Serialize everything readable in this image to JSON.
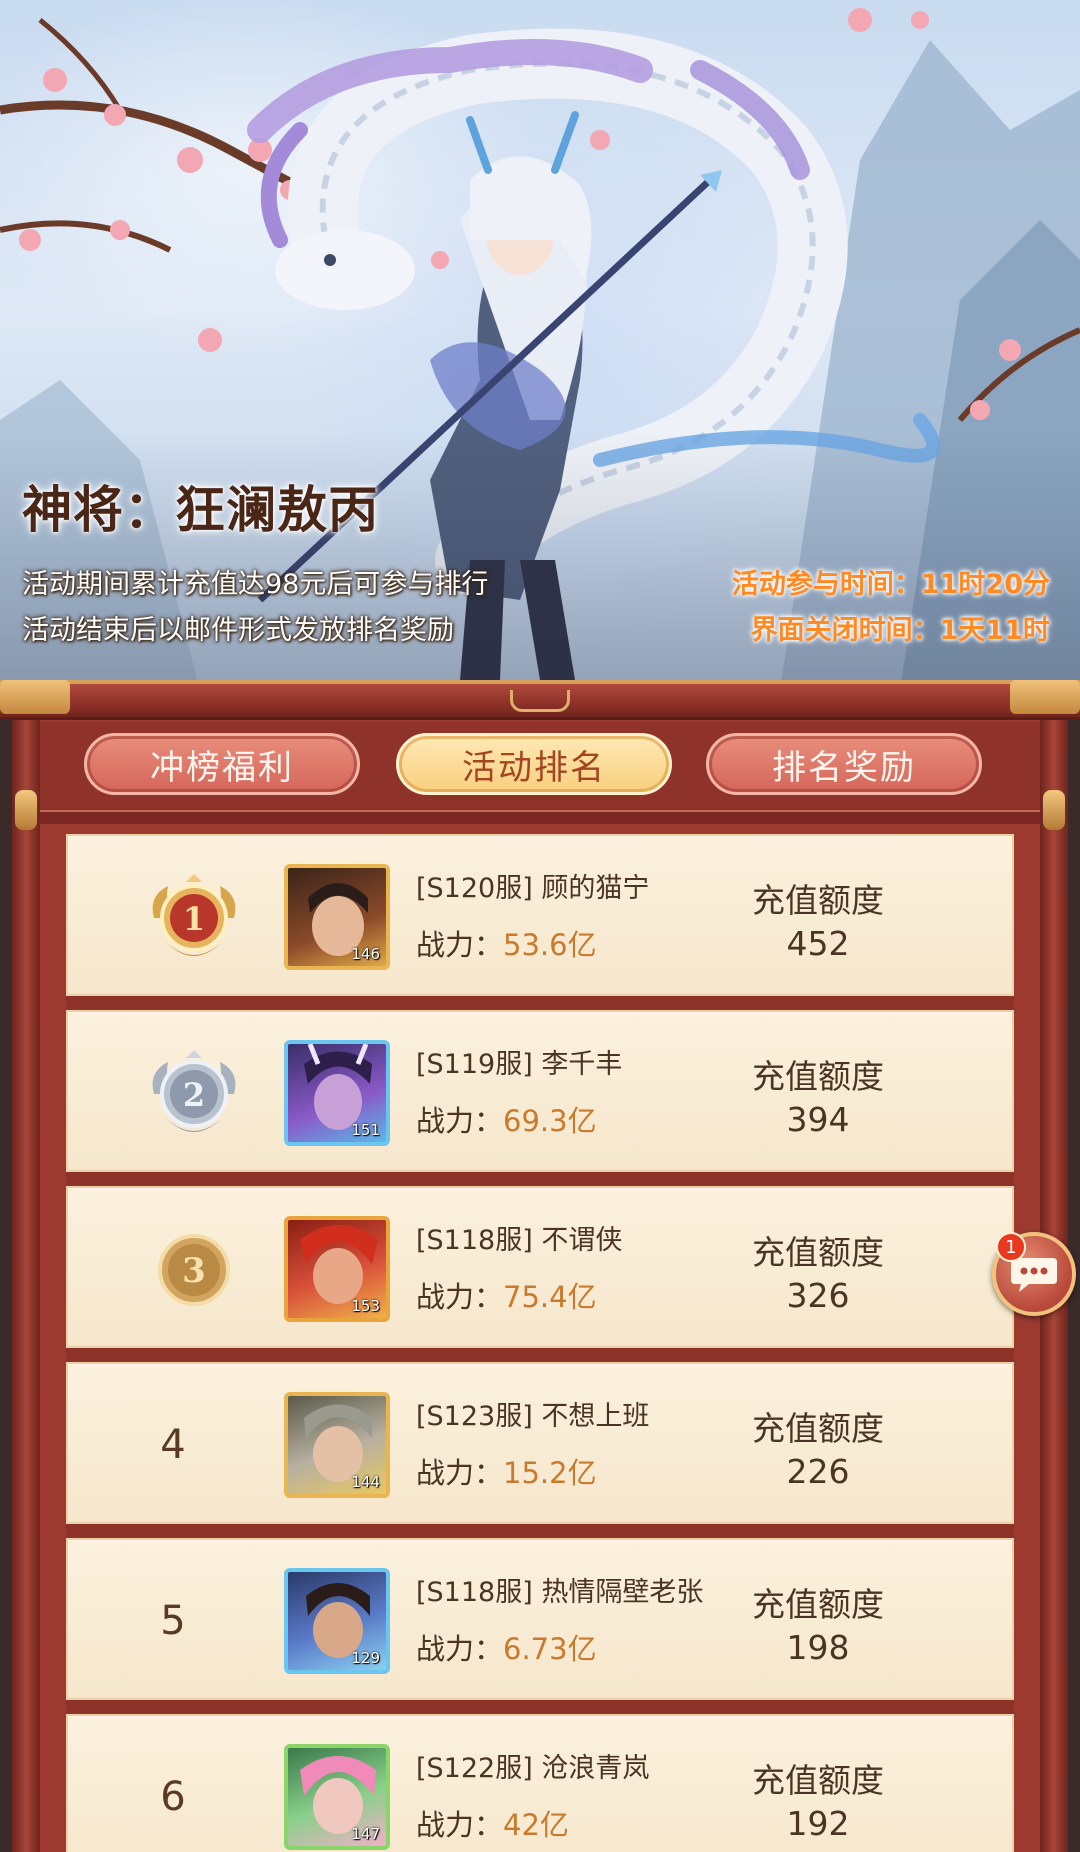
{
  "banner": {
    "hero_title": "神将：狂澜敖丙",
    "rule_line_1": "活动期间累计充值达98元后可参与排行",
    "rule_line_2": "活动结束后以邮件形式发放排名奖励",
    "participation_time": "活动参与时间：11时20分",
    "close_time": "界面关闭时间：1天11时"
  },
  "tabs": [
    {
      "label": "冲榜福利",
      "active": false
    },
    {
      "label": "活动排名",
      "active": true
    },
    {
      "label": "排名奖励",
      "active": false
    }
  ],
  "colors": {
    "frame_red": "#9c3a30",
    "row_cream": "#fbf1de",
    "power_orange": "#c97a2c",
    "timer_orange": "#ff8a24",
    "gold": "#e7b45e",
    "silver": "#b9c3cf",
    "bronze": "#d2a460"
  },
  "ranking": {
    "power_prefix": "战力：",
    "recharge_label": "充值额度",
    "rows": [
      {
        "rank": "1",
        "medal": "gold-medal-icon",
        "avatar_level": "146",
        "player": "[S120服] 顾的猫宁",
        "power": "53.6亿",
        "recharge": "452"
      },
      {
        "rank": "2",
        "medal": "silver-medal-icon",
        "avatar_level": "151",
        "player": "[S119服] 李千丰",
        "power": "69.3亿",
        "recharge": "394"
      },
      {
        "rank": "3",
        "medal": "bronze-medal-icon",
        "avatar_level": "153",
        "player": "[S118服] 不谓侠",
        "power": "75.4亿",
        "recharge": "326"
      },
      {
        "rank": "4",
        "medal": "",
        "avatar_level": "144",
        "player": "[S123服] 不想上班",
        "power": "15.2亿",
        "recharge": "226"
      },
      {
        "rank": "5",
        "medal": "",
        "avatar_level": "129",
        "player": "[S118服] 热情隔壁老张",
        "power": "6.73亿",
        "recharge": "198"
      },
      {
        "rank": "6",
        "medal": "",
        "avatar_level": "147",
        "player": "[S122服] 沧浪青岚",
        "power": "42亿",
        "recharge": "192"
      }
    ]
  },
  "chat": {
    "badge_count": "1",
    "icon": "chat-bubble-icon"
  }
}
